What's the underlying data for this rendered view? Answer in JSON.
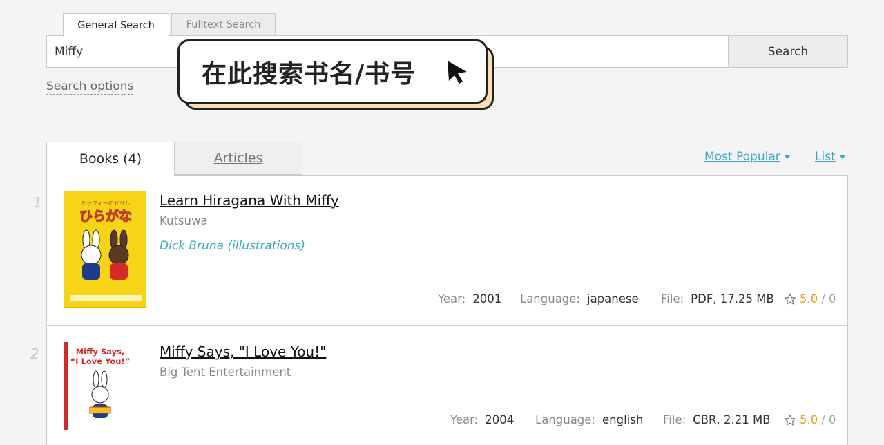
{
  "search_tabs": {
    "general": "General Search",
    "fulltext": "Fulltext Search"
  },
  "search": {
    "value": "Miffy",
    "button": "Search",
    "options": "Search options"
  },
  "callout": {
    "text": "在此搜索书名/书号"
  },
  "result_tabs": {
    "books": "Books (4)",
    "articles": "Articles"
  },
  "sort": {
    "popular": "Most Popular",
    "view": "List"
  },
  "labels": {
    "year": "Year:",
    "language": "Language:",
    "file": "File:"
  },
  "books": [
    {
      "index": "1",
      "title": "Learn Hiragana With Miffy",
      "publisher": "Kutsuwa",
      "author": "Dick Bruna (illustrations)",
      "year": "2001",
      "language": "japanese",
      "file": "PDF, 17.25 MB",
      "rating": "5.0",
      "rating_sep": "/",
      "rating_count": "0",
      "cover_text_top": "ミッフィーのドリル",
      "cover_text_main": "ひらがな"
    },
    {
      "index": "2",
      "title": "Miffy Says, \"I Love You!\"",
      "publisher": "Big Tent Entertainment",
      "year": "2004",
      "language": "english",
      "file": "CBR, 2.21 MB",
      "rating": "5.0",
      "rating_sep": "/",
      "rating_count": "0",
      "cover_text": "Miffy Says,",
      "cover_text2": "“I Love You!”"
    }
  ],
  "colors": {
    "accent": "#3aa7c7",
    "star": "#e8a321",
    "callout_shadow": "#f6dfb4"
  }
}
